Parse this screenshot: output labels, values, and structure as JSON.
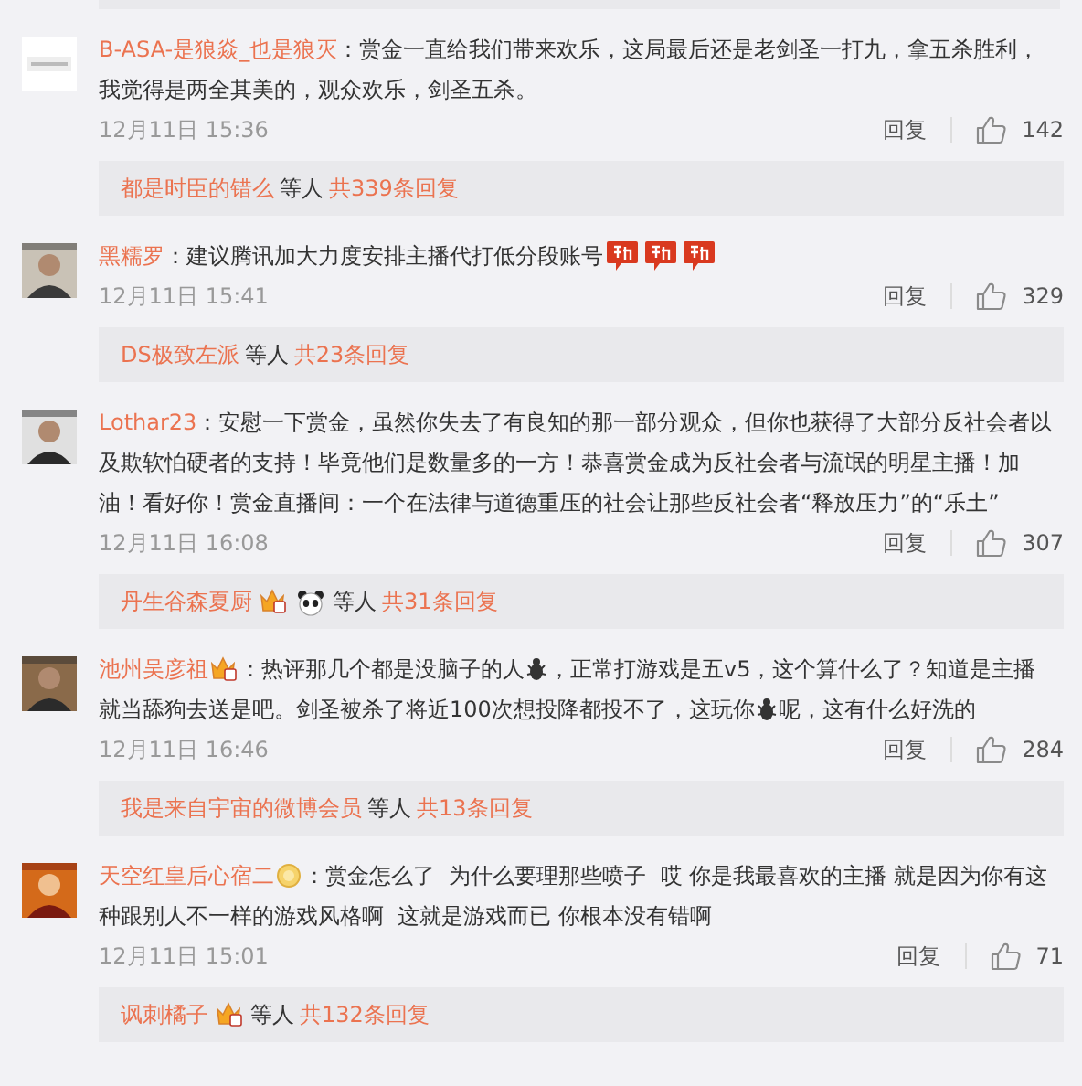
{
  "comments": [
    {
      "avatar": {
        "kind": "picture"
      },
      "lines": [
        [
          {
            "kind": "name",
            "text": "B-ASA-是狼焱_也是狼灭"
          },
          {
            "kind": "text",
            "text": "：赏金一直给我们带来欢乐，这局最后还是老剑圣一打九，拿五杀胜利，"
          }
        ],
        [
          {
            "kind": "text",
            "text": "我觉得是两全其美的，观众欢乐，剑圣五杀。"
          }
        ]
      ],
      "date": "12月11日 15:36",
      "reply_label": "回复",
      "likes": "142",
      "replies": [
        {
          "kind": "name",
          "text": "都是时臣的错么"
        },
        {
          "kind": "plain",
          "text": "等人"
        },
        {
          "kind": "link",
          "text": "共339条回复"
        }
      ]
    },
    {
      "avatar": {
        "kind": "picture"
      },
      "lines": [
        [
          {
            "kind": "name",
            "text": "黑糯罗"
          },
          {
            "kind": "text",
            "text": "：建议腾讯加大力度安排主播代打低分段账号"
          },
          {
            "kind": "sticker"
          },
          {
            "kind": "sticker"
          },
          {
            "kind": "sticker"
          }
        ]
      ],
      "date": "12月11日 15:41",
      "reply_label": "回复",
      "likes": "329",
      "replies": [
        {
          "kind": "name",
          "text": "DS极致左派"
        },
        {
          "kind": "plain",
          "text": "等人"
        },
        {
          "kind": "link",
          "text": "共23条回复"
        }
      ]
    },
    {
      "avatar": {
        "kind": "picture"
      },
      "lines": [
        [
          {
            "kind": "name",
            "text": "Lothar23"
          },
          {
            "kind": "text",
            "text": "：安慰一下赏金，虽然你失去了有良知的那一部分观众，但你也获得了大部分反社会者以"
          }
        ],
        [
          {
            "kind": "text",
            "text": "及欺软怕硬者的支持！毕竟他们是数量多的一方！恭喜赏金成为反社会者与流氓的明星主播！加"
          }
        ],
        [
          {
            "kind": "text",
            "text": "油！看好你！赏金直播间：一个在法律与道德重压的社会让那些反社会者“释放压力”的“乐土”"
          }
        ]
      ],
      "date": "12月11日 16:08",
      "reply_label": "回复",
      "likes": "307",
      "replies": [
        {
          "kind": "name",
          "text": "丹生谷森夏厨"
        },
        {
          "kind": "crown"
        },
        {
          "kind": "panda"
        },
        {
          "kind": "plain",
          "text": "等人"
        },
        {
          "kind": "link",
          "text": "共31条回复"
        }
      ]
    },
    {
      "avatar": {
        "kind": "picture"
      },
      "lines": [
        [
          {
            "kind": "name",
            "text": "池州吴彦祖"
          },
          {
            "kind": "crown"
          },
          {
            "kind": "text",
            "text": "：热评那几个都是没脑子的人"
          },
          {
            "kind": "bug"
          },
          {
            "kind": "text",
            "text": "，正常打游戏是五v5，这个算什么了？知道是主播"
          }
        ],
        [
          {
            "kind": "text",
            "text": "就当舔狗去送是吧。剑圣被杀了将近100次想投降都投不了，这玩你"
          },
          {
            "kind": "bug"
          },
          {
            "kind": "text",
            "text": "呢，这有什么好洗的"
          }
        ]
      ],
      "date": "12月11日 16:46",
      "reply_label": "回复",
      "likes": "284",
      "replies": [
        {
          "kind": "name",
          "text": "我是来自宇宙的微博会员"
        },
        {
          "kind": "plain",
          "text": "等人"
        },
        {
          "kind": "link",
          "text": "共13条回复"
        }
      ]
    },
    {
      "avatar": {
        "kind": "picture"
      },
      "lines": [
        [
          {
            "kind": "name",
            "text": "天空红皇后心宿二"
          },
          {
            "kind": "medal"
          },
          {
            "kind": "text",
            "text": "：赏金怎么了  为什么要理那些喷子  哎 你是我最喜欢的主播 就是因为你有这"
          }
        ],
        [
          {
            "kind": "text",
            "text": "种跟别人不一样的游戏风格啊  这就是游戏而已 你根本没有错啊"
          }
        ]
      ],
      "date": "12月11日 15:01",
      "reply_label": "回复",
      "likes": "71",
      "replies": [
        {
          "kind": "name",
          "text": "讽刺橘子"
        },
        {
          "kind": "crown"
        },
        {
          "kind": "plain",
          "text": "等人"
        },
        {
          "kind": "link",
          "text": "共132条回复"
        }
      ]
    }
  ]
}
